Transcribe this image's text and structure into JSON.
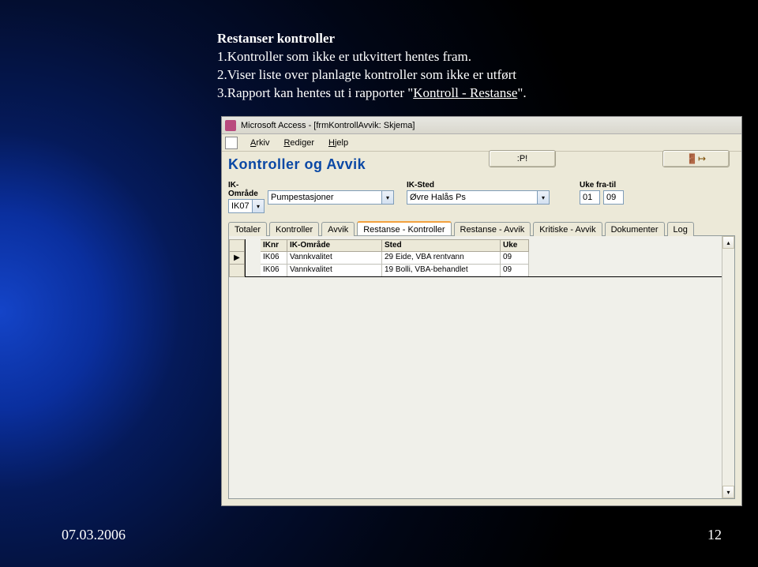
{
  "slide": {
    "heading": "Restanser kontroller",
    "line1": "1.Kontroller som ikke er utkvittert hentes fram.",
    "line2": "2.Viser liste over planlagte kontroller som ikke er utført",
    "line3_prefix": "3.Rapport kan hentes ut i rapporter \"",
    "line3_link": "Kontroll - Restanse",
    "line3_suffix": "\"."
  },
  "footer": {
    "date": "07.03.2006",
    "page": "12"
  },
  "window": {
    "title": "Microsoft Access - [frmKontrollAvvik: Skjema]"
  },
  "menu": {
    "arkiv": "Arkiv",
    "rediger": "Rediger",
    "hjelp": "Hjelp"
  },
  "form": {
    "heading": "Kontroller og Avvik",
    "btn_refresh": "",
    "btn_exit": ""
  },
  "filters": {
    "ik_omrade_label": "IK-Område",
    "ik_omrade_code": "IK07",
    "ik_omrade_text": "Pumpestasjoner",
    "ik_sted_label": "IK-Sted",
    "ik_sted_text": "Øvre Halås Ps",
    "uke_label": "Uke fra-til",
    "uke_fra": "01",
    "uke_til": "09"
  },
  "tabs": [
    "Totaler",
    "Kontroller",
    "Avvik",
    "Restanse - Kontroller",
    "Restanse - Avvik",
    "Kritiske - Avvik",
    "Dokumenter",
    "Log"
  ],
  "grid": {
    "headers": {
      "iknr": "IKnr",
      "omrade": "IK-Område",
      "sted": "Sted",
      "uke": "Uke"
    },
    "rows": [
      {
        "iknr": "IK06",
        "omrade": "Vannkvalitet",
        "sted": "29 Eide, VBA rentvann",
        "uke": "09"
      },
      {
        "iknr": "IK06",
        "omrade": "Vannkvalitet",
        "sted": "19 Bolli, VBA-behandlet",
        "uke": "09"
      }
    ]
  }
}
